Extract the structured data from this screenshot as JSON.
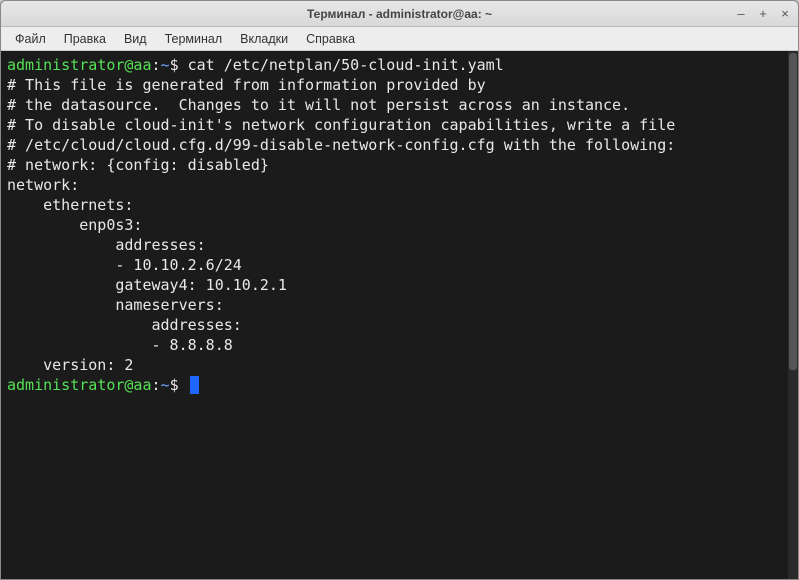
{
  "titlebar": {
    "title": "Терминал - administrator@aa: ~"
  },
  "menu": {
    "file": "Файл",
    "edit": "Правка",
    "view": "Вид",
    "terminal": "Терминал",
    "tabs": "Вкладки",
    "help": "Справка"
  },
  "prompt": {
    "user_host": "administrator@aa",
    "colon": ":",
    "path": "~",
    "symbol": "$"
  },
  "command": "cat /etc/netplan/50-cloud-init.yaml",
  "output": {
    "l1": "# This file is generated from information provided by",
    "l2": "# the datasource.  Changes to it will not persist across an instance.",
    "l3": "# To disable cloud-init's network configuration capabilities, write a file",
    "l4": "# /etc/cloud/cloud.cfg.d/99-disable-network-config.cfg with the following:",
    "l5": "# network: {config: disabled}",
    "l6": "network:",
    "l7": "    ethernets:",
    "l8": "        enp0s3:",
    "l9": "            addresses:",
    "l10": "            - 10.10.2.6/24",
    "l11": "            gateway4: 10.10.2.1",
    "l12": "            nameservers:",
    "l13": "                addresses:",
    "l14": "                - 8.8.8.8",
    "l15": "    version: 2"
  }
}
